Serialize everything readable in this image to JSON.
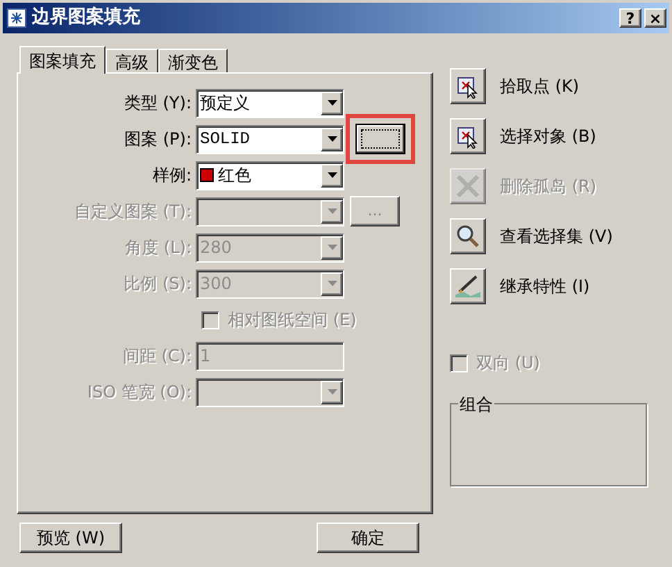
{
  "window": {
    "title": "边界图案填充",
    "buttons": [
      "?",
      "×"
    ]
  },
  "tabs": [
    {
      "label": "图案填充",
      "selected": true
    },
    {
      "label": "高级",
      "selected": false
    },
    {
      "label": "渐变色",
      "selected": false
    }
  ],
  "fields": [
    {
      "kind": "combo",
      "label": "类型 (Y):",
      "value": "预定义",
      "disabled": false
    },
    {
      "kind": "combo",
      "label": "图案 (P):",
      "value": "SOLID",
      "disabled": false,
      "browse": {
        "focused": true,
        "highlighted": true
      }
    },
    {
      "kind": "combo",
      "label": "样例:",
      "value": "红色",
      "disabled": false,
      "color": "#cc0000"
    },
    {
      "kind": "combo",
      "label": "自定义图案 (T):",
      "disabled": true,
      "browse": {
        "label": "...",
        "focused": false
      }
    },
    {
      "kind": "combo",
      "label": "角度 (L):",
      "value": "280",
      "disabled": true
    },
    {
      "kind": "combo",
      "label": "比例 (S):",
      "value": "300",
      "disabled": true
    },
    {
      "kind": "checkbox",
      "label": "相对图纸空间 (E)",
      "checked": false,
      "disabled": true
    },
    {
      "kind": "text",
      "label": "间距 (C):",
      "value": "1",
      "disabled": true
    },
    {
      "kind": "combo",
      "label": "ISO 笔宽 (O):",
      "disabled": true
    }
  ],
  "actions": [
    {
      "kind": "pick",
      "label": "拾取点 (K)",
      "disabled": false
    },
    {
      "kind": "select",
      "label": "选择对象 (B)",
      "disabled": false
    },
    {
      "kind": "remove",
      "label": "删除孤岛 (R)",
      "disabled": true
    },
    {
      "kind": "view",
      "label": "查看选择集 (V)",
      "disabled": false
    },
    {
      "kind": "inherit",
      "label": "继承特性 (I)",
      "disabled": false
    }
  ],
  "option": {
    "label": "双向 (U)",
    "checked": false,
    "disabled": true
  },
  "group": {
    "title": "组合"
  },
  "footer_buttons": [
    "预览 (W)",
    "确定"
  ]
}
